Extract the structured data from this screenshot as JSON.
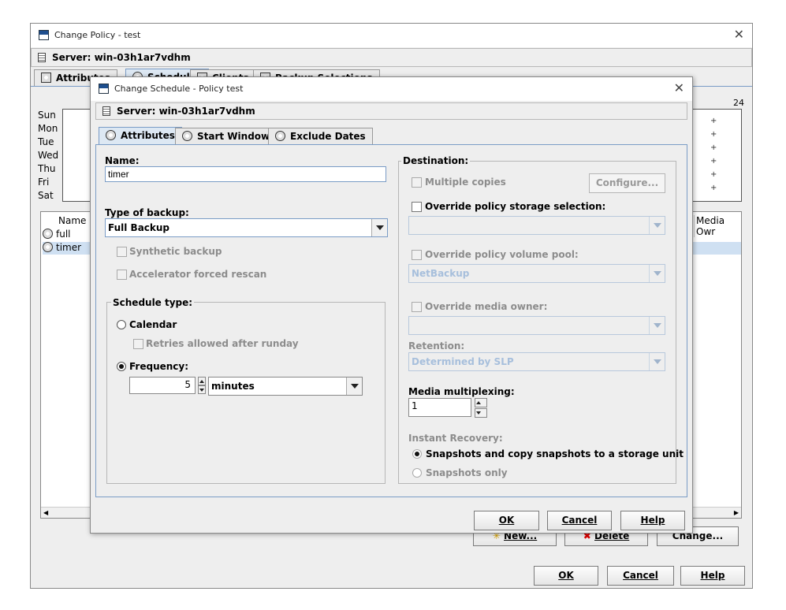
{
  "outer": {
    "title": "Change Policy - test",
    "server_label": "Server:",
    "server_name": "win-03h1ar7vdhm",
    "tabs": [
      "Attributes",
      "Schedules",
      "Clients",
      "Backup Selections"
    ],
    "days": [
      "Sun",
      "Mon",
      "Tue",
      "Wed",
      "Thu",
      "Fri",
      "Sat"
    ],
    "hour_label": "24",
    "list_headers": {
      "name": "Name",
      "media_owner": "Media Owr"
    },
    "list_rows": [
      "full",
      "timer"
    ],
    "buttons": {
      "new": "New...",
      "delete": "Delete",
      "change": "Change...",
      "ok": "OK",
      "cancel": "Cancel",
      "help": "Help"
    }
  },
  "dialog": {
    "title": "Change Schedule - Policy test",
    "server_label": "Server:",
    "server_name": "win-03h1ar7vdhm",
    "tabs": [
      "Attributes",
      "Start Window",
      "Exclude Dates"
    ],
    "name_label": "Name:",
    "name_value": "timer",
    "type_label": "Type of backup:",
    "type_value": "Full Backup",
    "synthetic_label": "Synthetic backup",
    "accelerator_label": "Accelerator forced rescan",
    "schedule_type_title": "Schedule type:",
    "calendar_label": "Calendar",
    "retries_label": "Retries allowed after runday",
    "frequency_label": "Frequency:",
    "frequency_value": "5",
    "frequency_unit": "minutes",
    "destination_title": "Destination:",
    "multiple_copies_label": "Multiple copies",
    "configure_label": "Configure...",
    "override_storage_label": "Override policy storage selection:",
    "override_volume_label": "Override policy volume pool:",
    "volume_pool_value": "NetBackup",
    "override_owner_label": "Override media owner:",
    "retention_label": "Retention:",
    "retention_value": "Determined by SLP",
    "multiplexing_label": "Media multiplexing:",
    "multiplexing_value": "1",
    "instant_recovery_label": "Instant Recovery:",
    "snap_copy_label": "Snapshots and copy snapshots to a storage unit",
    "snap_only_label": "Snapshots only",
    "buttons": {
      "ok": "OK",
      "cancel": "Cancel",
      "help": "Help"
    }
  }
}
